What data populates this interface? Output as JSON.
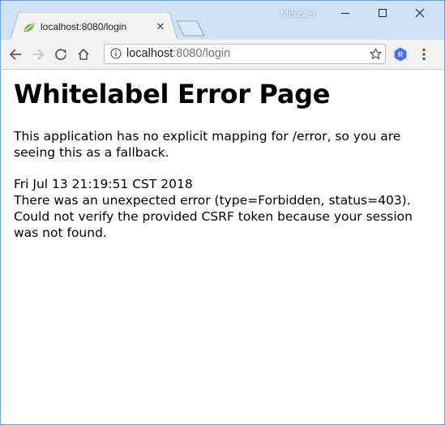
{
  "browser": {
    "tab": {
      "title": "localhost:8080/login",
      "favicon": "spring-leaf-icon",
      "close_glyph": "✕"
    },
    "profile_name": "Monster",
    "window_controls": [
      "minimize",
      "maximize",
      "close"
    ],
    "toolbar": {
      "url_host": "localhost",
      "url_rest": ":8080/login",
      "extension_label": "R",
      "icons": [
        "back-arrow-icon",
        "forward-arrow-icon",
        "reload-icon",
        "home-icon",
        "info-icon",
        "star-icon",
        "more-vert-icon"
      ]
    },
    "colors": {
      "frame": "#cfe1f5",
      "toolbar": "#f2f2f2",
      "extension_badge": "#4a6ef0",
      "favicon_leaf": "#6db33f"
    }
  },
  "page": {
    "heading": "Whitelabel Error Page",
    "description_line1": "This application has no explicit mapping for /error, so you are",
    "description_line2": "seeing this as a fallback.",
    "timestamp": "Fri Jul 13 21:19:51 CST 2018",
    "error_line": "There was an unexpected error (type=Forbidden, status=403).",
    "message_line1": "Could not verify the provided CSRF token because your session",
    "message_line2": "was not found."
  }
}
